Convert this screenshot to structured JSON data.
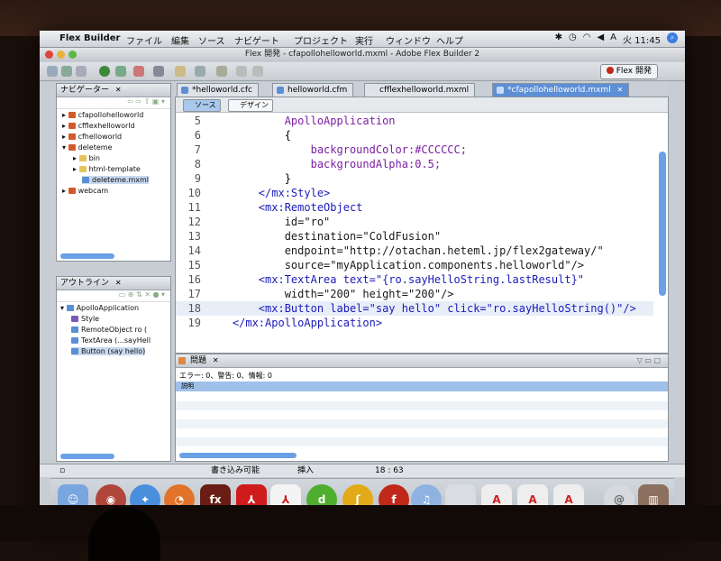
{
  "menubar": {
    "app": "Flex Builder",
    "items": [
      "ファイル",
      "編集",
      "ソース",
      "ナビゲート",
      "プロジェクト",
      "実行",
      "ウィンドウ",
      "ヘルプ"
    ],
    "clock": "火 11:45"
  },
  "window": {
    "title": "Flex 開発 - cfapollohelloworld.mxml - Adobe Flex Builder 2",
    "perspective": "Flex 開発"
  },
  "navigator": {
    "title": "ナビゲーター",
    "items": [
      {
        "label": "cfapollohelloworld"
      },
      {
        "label": "cfflexhelloworld"
      },
      {
        "label": "cfhelloworld"
      },
      {
        "label": "deleteme"
      },
      {
        "label": "bin"
      },
      {
        "label": "html-template"
      },
      {
        "label": "deleteme.mxml"
      },
      {
        "label": "webcam"
      }
    ]
  },
  "outline": {
    "title": "アウトライン",
    "items": [
      {
        "label": "ApolloApplication"
      },
      {
        "label": "Style"
      },
      {
        "label": "RemoteObject ro ("
      },
      {
        "label": "TextArea (...sayHell"
      },
      {
        "label": "Button (say hello)"
      }
    ]
  },
  "tabs": [
    {
      "label": "*helloworld.cfc"
    },
    {
      "label": "helloworld.cfm"
    },
    {
      "label": "cfflexhelloworld.mxml"
    },
    {
      "label": "*cfapollohelloworld.mxml"
    }
  ],
  "editor": {
    "mode_source": "ソース",
    "mode_design": "デザイン",
    "lines": [
      {
        "num": "5",
        "text": "            ApolloApplication"
      },
      {
        "num": "6",
        "text": "            {"
      },
      {
        "num": "7",
        "text": "                backgroundColor:#CCCCCC;"
      },
      {
        "num": "8",
        "text": "                backgroundAlpha:0.5;"
      },
      {
        "num": "9",
        "text": "            }"
      },
      {
        "num": "10",
        "text": "        </mx:Style>"
      },
      {
        "num": "11",
        "text": "        <mx:RemoteObject"
      },
      {
        "num": "12",
        "text": "            id=\"ro\""
      },
      {
        "num": "13",
        "text": "            destination=\"ColdFusion\""
      },
      {
        "num": "14",
        "text": "            endpoint=\"http://otachan.heteml.jp/flex2gateway/\""
      },
      {
        "num": "15",
        "text": "            source=\"myApplication.components.helloworld\"/>"
      },
      {
        "num": "16",
        "text": "        <mx:TextArea text=\"{ro.sayHelloString.lastResult}\""
      },
      {
        "num": "17",
        "text": "            width=\"200\" height=\"200\"/>"
      },
      {
        "num": "18",
        "text": "        <mx:Button label=\"say hello\" click=\"ro.sayHelloString()\"/>"
      },
      {
        "num": "19",
        "text": "    </mx:ApolloApplication>"
      }
    ]
  },
  "problems": {
    "title": "問題",
    "summary": "エラー: 0、警告: 0、情報: 0",
    "column": "説明"
  },
  "status": {
    "writable": "書き込み可能",
    "insert": "挿入",
    "position": "18 : 63"
  },
  "colors": {
    "tag": "#1b1bb8",
    "value": "#b0106f",
    "style": "#7b1fa2",
    "active_tab": "#5d8fd6"
  }
}
